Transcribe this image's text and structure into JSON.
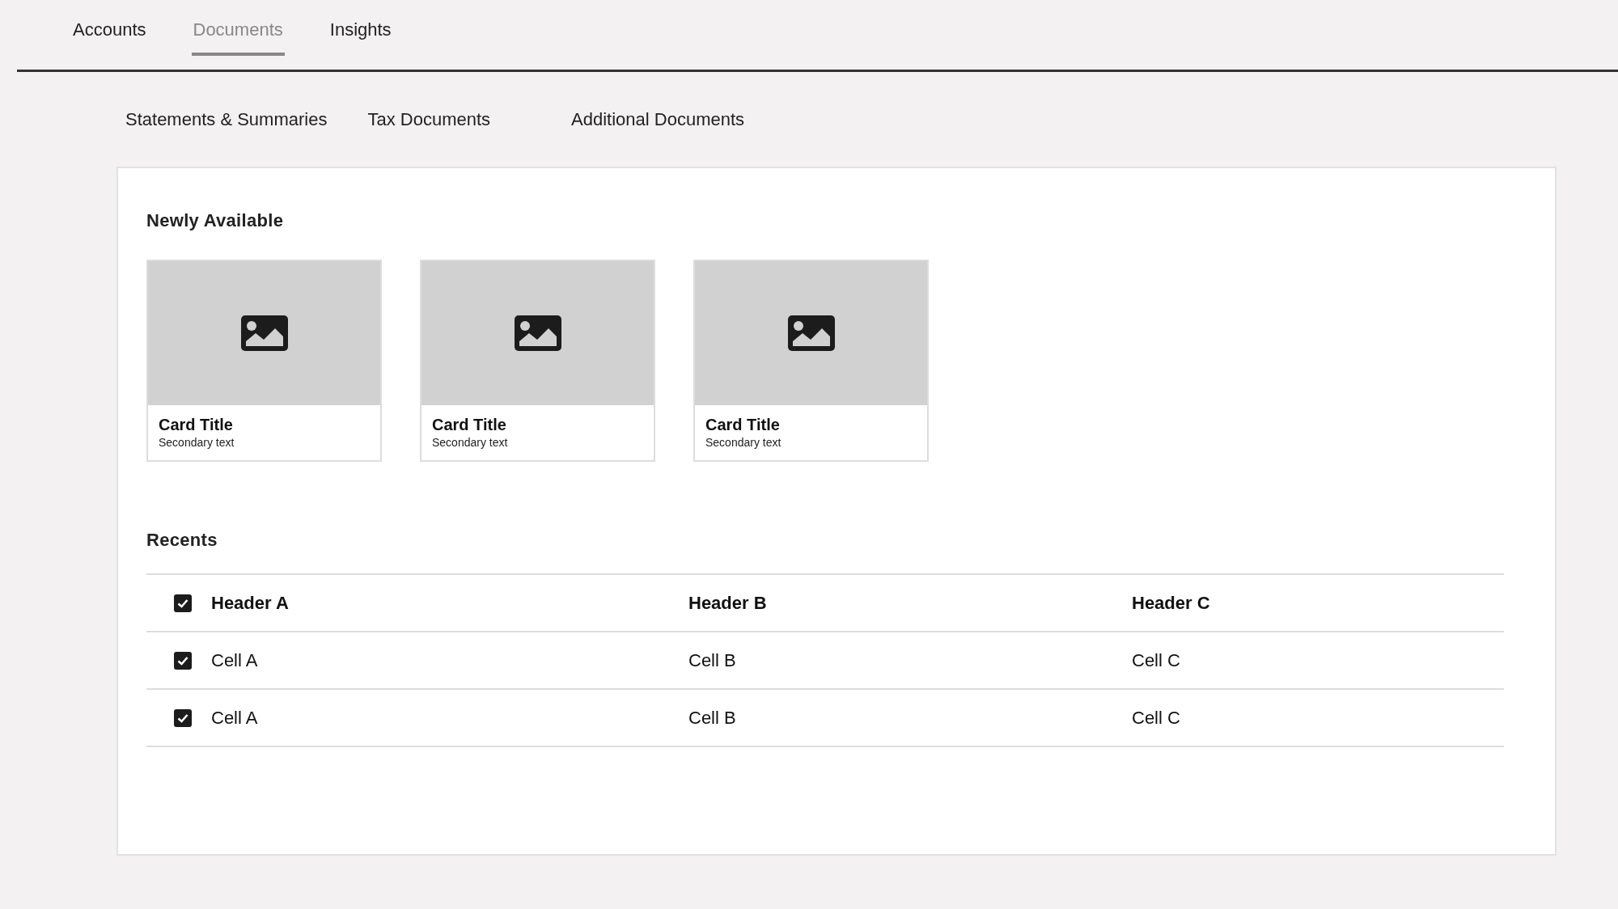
{
  "tabs": [
    {
      "label": "Accounts",
      "selected": false
    },
    {
      "label": "Documents",
      "selected": true
    },
    {
      "label": "Insights",
      "selected": false
    }
  ],
  "sub_tabs": [
    {
      "label": "Statements & Summaries"
    },
    {
      "label": "Tax Documents"
    },
    {
      "label": "Additional Documents"
    }
  ],
  "newly_available": {
    "title": "Newly Available",
    "cards": [
      {
        "title": "Card Title",
        "secondary": "Secondary text"
      },
      {
        "title": "Card Title",
        "secondary": "Secondary text"
      },
      {
        "title": "Card Title",
        "secondary": "Secondary text"
      }
    ]
  },
  "recents": {
    "title": "Recents",
    "table": {
      "header": {
        "checked": true,
        "columns": [
          "Header A",
          "Header B",
          "Header C"
        ]
      },
      "rows": [
        {
          "checked": true,
          "cells": [
            "Cell A",
            "Cell B",
            "Cell C"
          ]
        },
        {
          "checked": true,
          "cells": [
            "Cell A",
            "Cell B",
            "Cell C"
          ]
        }
      ]
    }
  }
}
